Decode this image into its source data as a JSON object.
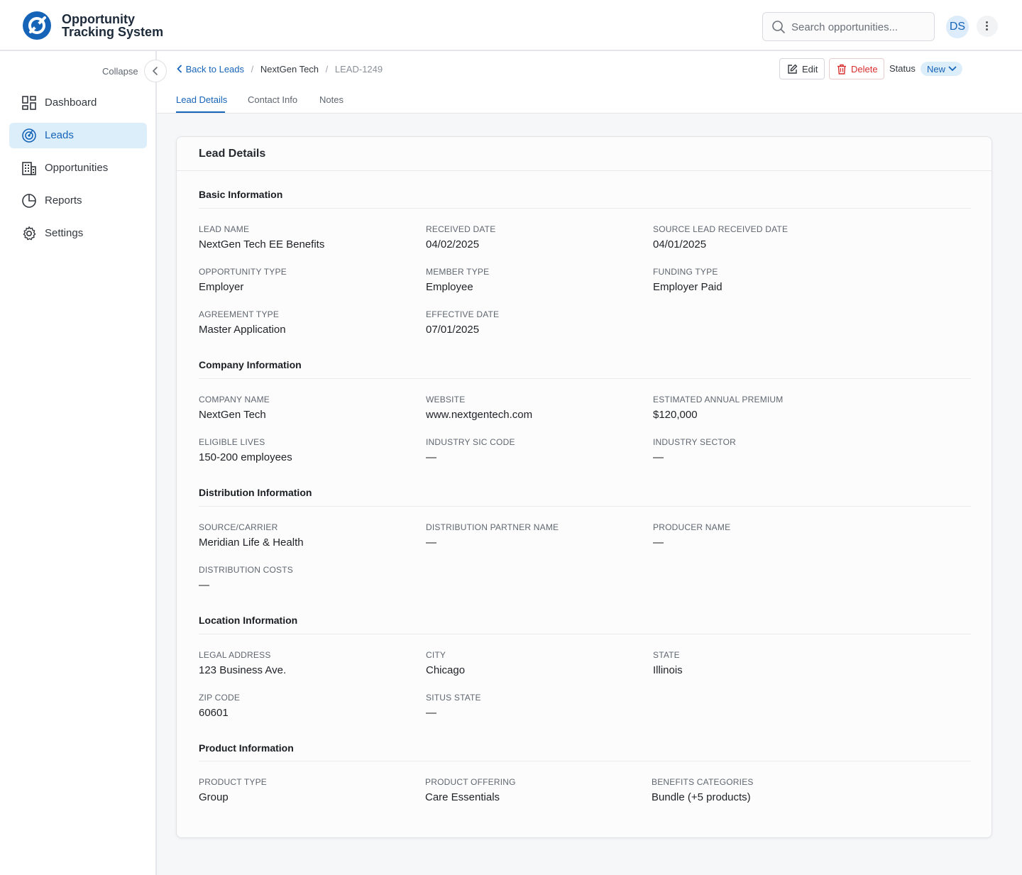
{
  "app": {
    "title_line1": "Opportunity",
    "title_line2": "Tracking System",
    "brand_color": "#1664b8"
  },
  "search": {
    "placeholder": "Search opportunities..."
  },
  "user": {
    "initials": "DS"
  },
  "sidebar": {
    "collapse_label": "Collapse",
    "items": [
      {
        "label": "Dashboard",
        "icon": "dashboard-icon",
        "active": false
      },
      {
        "label": "Leads",
        "icon": "target-icon",
        "active": true
      },
      {
        "label": "Opportunities",
        "icon": "building-icon",
        "active": false
      },
      {
        "label": "Reports",
        "icon": "pie-chart-icon",
        "active": false
      },
      {
        "label": "Settings",
        "icon": "gear-icon",
        "active": false
      }
    ]
  },
  "breadcrumb": {
    "back": "Back to Leads",
    "company": "NextGen Tech",
    "lead_id": "LEAD-1249"
  },
  "actions": {
    "edit": "Edit",
    "delete": "Delete",
    "status_label": "Status",
    "status_value": "New"
  },
  "tabs": [
    {
      "label": "Lead Details",
      "active": true
    },
    {
      "label": "Contact Info",
      "active": false
    },
    {
      "label": "Notes",
      "active": false
    }
  ],
  "card": {
    "title": "Lead Details",
    "sections": [
      {
        "title": "Basic Information",
        "fields": [
          {
            "label": "Lead Name",
            "value": "NextGen Tech EE Benefits"
          },
          {
            "label": "Received Date",
            "value": "04/02/2025"
          },
          {
            "label": "Source Lead Received Date",
            "value": "04/01/2025"
          },
          {
            "label": "Opportunity Type",
            "value": "Employer"
          },
          {
            "label": "Member Type",
            "value": "Employee"
          },
          {
            "label": "Funding Type",
            "value": "Employer Paid"
          },
          {
            "label": "Agreement Type",
            "value": "Master Application"
          },
          {
            "label": "Effective Date",
            "value": "07/01/2025"
          }
        ]
      },
      {
        "title": "Company Information",
        "fields": [
          {
            "label": "Company Name",
            "value": "NextGen Tech"
          },
          {
            "label": "Website",
            "value": "www.nextgentech.com"
          },
          {
            "label": "Estimated Annual Premium",
            "value": "$120,000"
          },
          {
            "label": "Eligible Lives",
            "value": "150-200 employees"
          },
          {
            "label": "Industry SIC Code",
            "value": "—"
          },
          {
            "label": "Industry Sector",
            "value": "—"
          }
        ]
      },
      {
        "title": "Distribution Information",
        "fields": [
          {
            "label": "Source/Carrier",
            "value": "Meridian Life & Health"
          },
          {
            "label": "Distribution Partner Name",
            "value": "—"
          },
          {
            "label": "Producer Name",
            "value": "—"
          },
          {
            "label": "Distribution Costs",
            "value": "—"
          }
        ]
      },
      {
        "title": "Location Information",
        "fields": [
          {
            "label": "Legal Address",
            "value": "123 Business Ave."
          },
          {
            "label": "City",
            "value": "Chicago"
          },
          {
            "label": "State",
            "value": "Illinois"
          },
          {
            "label": "Zip Code",
            "value": "60601"
          },
          {
            "label": "Situs State",
            "value": "—"
          }
        ]
      },
      {
        "title": "Product Information",
        "fields": [
          {
            "label": "Product Type",
            "value": "Group"
          },
          {
            "label": "Product Offering",
            "value": "Care Essentials"
          },
          {
            "label": "Benefits Categories",
            "value": "Bundle (+5 products)"
          }
        ]
      }
    ]
  }
}
